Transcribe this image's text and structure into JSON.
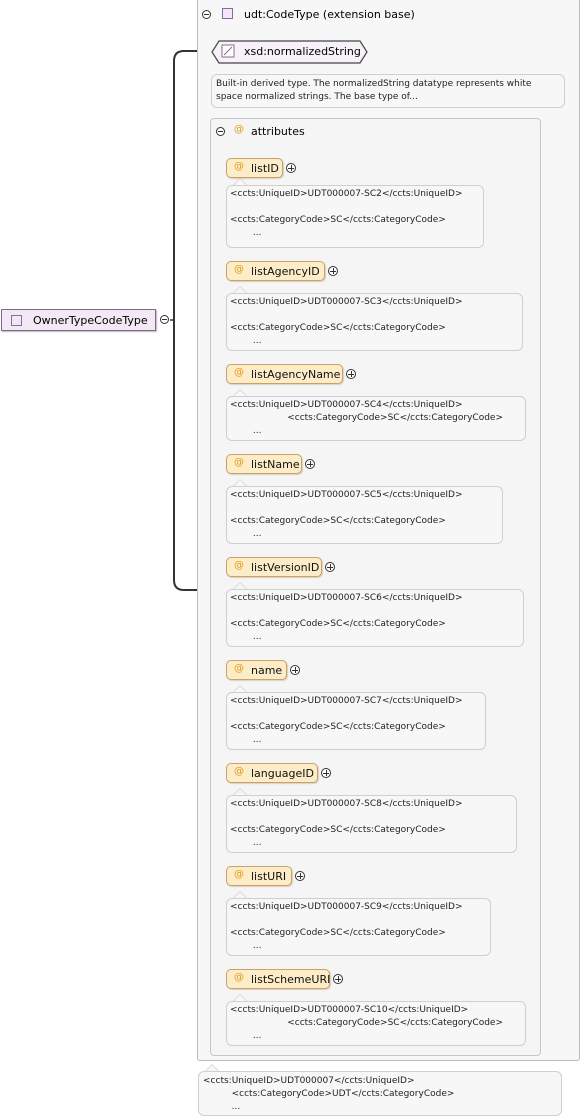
{
  "root": {
    "name": "OwnerTypeCodeType"
  },
  "base_type": {
    "label": "udt:CodeType (extension base)"
  },
  "simple_type": {
    "label": "xsd:normalizedString",
    "doc_line1": "Built-in derived type. The normalizedString datatype represents white",
    "doc_line2": "space normalized strings. The base type of..."
  },
  "attributes_group": {
    "label": "attributes"
  },
  "attributes": [
    {
      "name": "listID",
      "doc": [
        "<ccts:UniqueID>UDT000007-SC2</ccts:UniqueID>",
        "",
        "<ccts:CategoryCode>SC</ccts:CategoryCode>",
        "        ..."
      ]
    },
    {
      "name": "listAgencyID",
      "doc": [
        "<ccts:UniqueID>UDT000007-SC3</ccts:UniqueID>",
        "",
        "<ccts:CategoryCode>SC</ccts:CategoryCode>",
        "        ..."
      ]
    },
    {
      "name": "listAgencyName",
      "doc": [
        "<ccts:UniqueID>UDT000007-SC4</ccts:UniqueID>",
        "                    <ccts:CategoryCode>SC</ccts:CategoryCode>",
        "        ..."
      ]
    },
    {
      "name": "listName",
      "doc": [
        "<ccts:UniqueID>UDT000007-SC5</ccts:UniqueID>",
        "",
        "<ccts:CategoryCode>SC</ccts:CategoryCode>",
        "        ..."
      ]
    },
    {
      "name": "listVersionID",
      "doc": [
        "<ccts:UniqueID>UDT000007-SC6</ccts:UniqueID>",
        "",
        "<ccts:CategoryCode>SC</ccts:CategoryCode>",
        "        ..."
      ]
    },
    {
      "name": "name",
      "doc": [
        "<ccts:UniqueID>UDT000007-SC7</ccts:UniqueID>",
        "",
        "<ccts:CategoryCode>SC</ccts:CategoryCode>",
        "        ..."
      ]
    },
    {
      "name": "languageID",
      "doc": [
        "<ccts:UniqueID>UDT000007-SC8</ccts:UniqueID>",
        "",
        "<ccts:CategoryCode>SC</ccts:CategoryCode>",
        "        ..."
      ]
    },
    {
      "name": "listURI",
      "doc": [
        "<ccts:UniqueID>UDT000007-SC9</ccts:UniqueID>",
        "",
        "<ccts:CategoryCode>SC</ccts:CategoryCode>",
        "        ..."
      ]
    },
    {
      "name": "listSchemeURI",
      "doc": [
        "<ccts:UniqueID>UDT000007-SC10</ccts:UniqueID>",
        "                    <ccts:CategoryCode>SC</ccts:CategoryCode>",
        "        ..."
      ]
    }
  ],
  "bottom_doc": [
    "<ccts:UniqueID>UDT000007</ccts:UniqueID>",
    "          <ccts:CategoryCode>UDT</ccts:CategoryCode>",
    "          ..."
  ]
}
